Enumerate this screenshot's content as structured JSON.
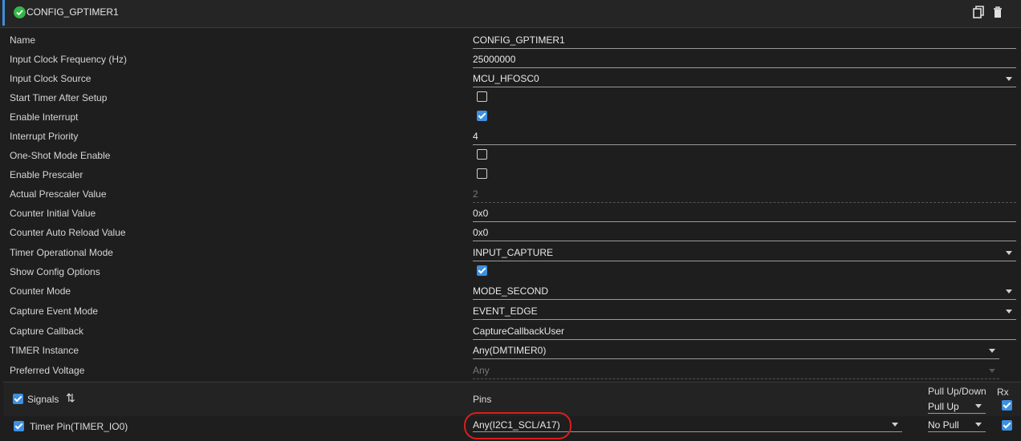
{
  "header": {
    "title": "CONFIG_GPTIMER1",
    "status_icon": "check-circle-icon",
    "status_color": "#35b547",
    "accent_color": "#3d8fe0",
    "actions": [
      "copy-icon",
      "delete-icon"
    ]
  },
  "fields": {
    "name": {
      "label": "Name",
      "value": "CONFIG_GPTIMER1"
    },
    "clock_freq": {
      "label": "Input Clock Frequency (Hz)",
      "value": "25000000"
    },
    "clock_source": {
      "label": "Input Clock Source",
      "value": "MCU_HFOSC0"
    },
    "start_after_setup": {
      "label": "Start Timer After Setup",
      "checked": false
    },
    "enable_interrupt": {
      "label": "Enable Interrupt",
      "checked": true
    },
    "interrupt_priority": {
      "label": "Interrupt Priority",
      "value": "4"
    },
    "one_shot": {
      "label": "One-Shot Mode Enable",
      "checked": false
    },
    "enable_prescaler": {
      "label": "Enable Prescaler",
      "checked": false
    },
    "actual_prescaler": {
      "label": "Actual Prescaler Value",
      "value": "2"
    },
    "counter_initial": {
      "label": "Counter Initial Value",
      "value": "0x0"
    },
    "counter_reload": {
      "label": "Counter Auto Reload Value",
      "value": "0x0"
    },
    "op_mode": {
      "label": "Timer Operational Mode",
      "value": "INPUT_CAPTURE"
    },
    "show_config": {
      "label": "Show Config Options",
      "checked": true
    },
    "counter_mode": {
      "label": "Counter Mode",
      "value": "MODE_SECOND"
    },
    "capture_event": {
      "label": "Capture Event Mode",
      "value": "EVENT_EDGE"
    },
    "capture_callback": {
      "label": "Capture Callback",
      "value": "CaptureCallbackUser"
    },
    "timer_instance": {
      "label": "TIMER Instance",
      "value": "Any(DMTIMER0)"
    },
    "preferred_voltage": {
      "label": "Preferred Voltage",
      "value": "Any"
    }
  },
  "signals": {
    "header_label": "Signals",
    "pins_header": "Pins",
    "pull_header": "Pull Up/Down",
    "rx_header": "Rx",
    "pull_all_value": "Pull Up",
    "rows": [
      {
        "name": "Timer Pin(TIMER_IO0)",
        "pin": "Any(I2C1_SCL/A17)",
        "pull": "No Pull",
        "rx": true
      }
    ]
  },
  "annotation_color": "#d91e1e"
}
